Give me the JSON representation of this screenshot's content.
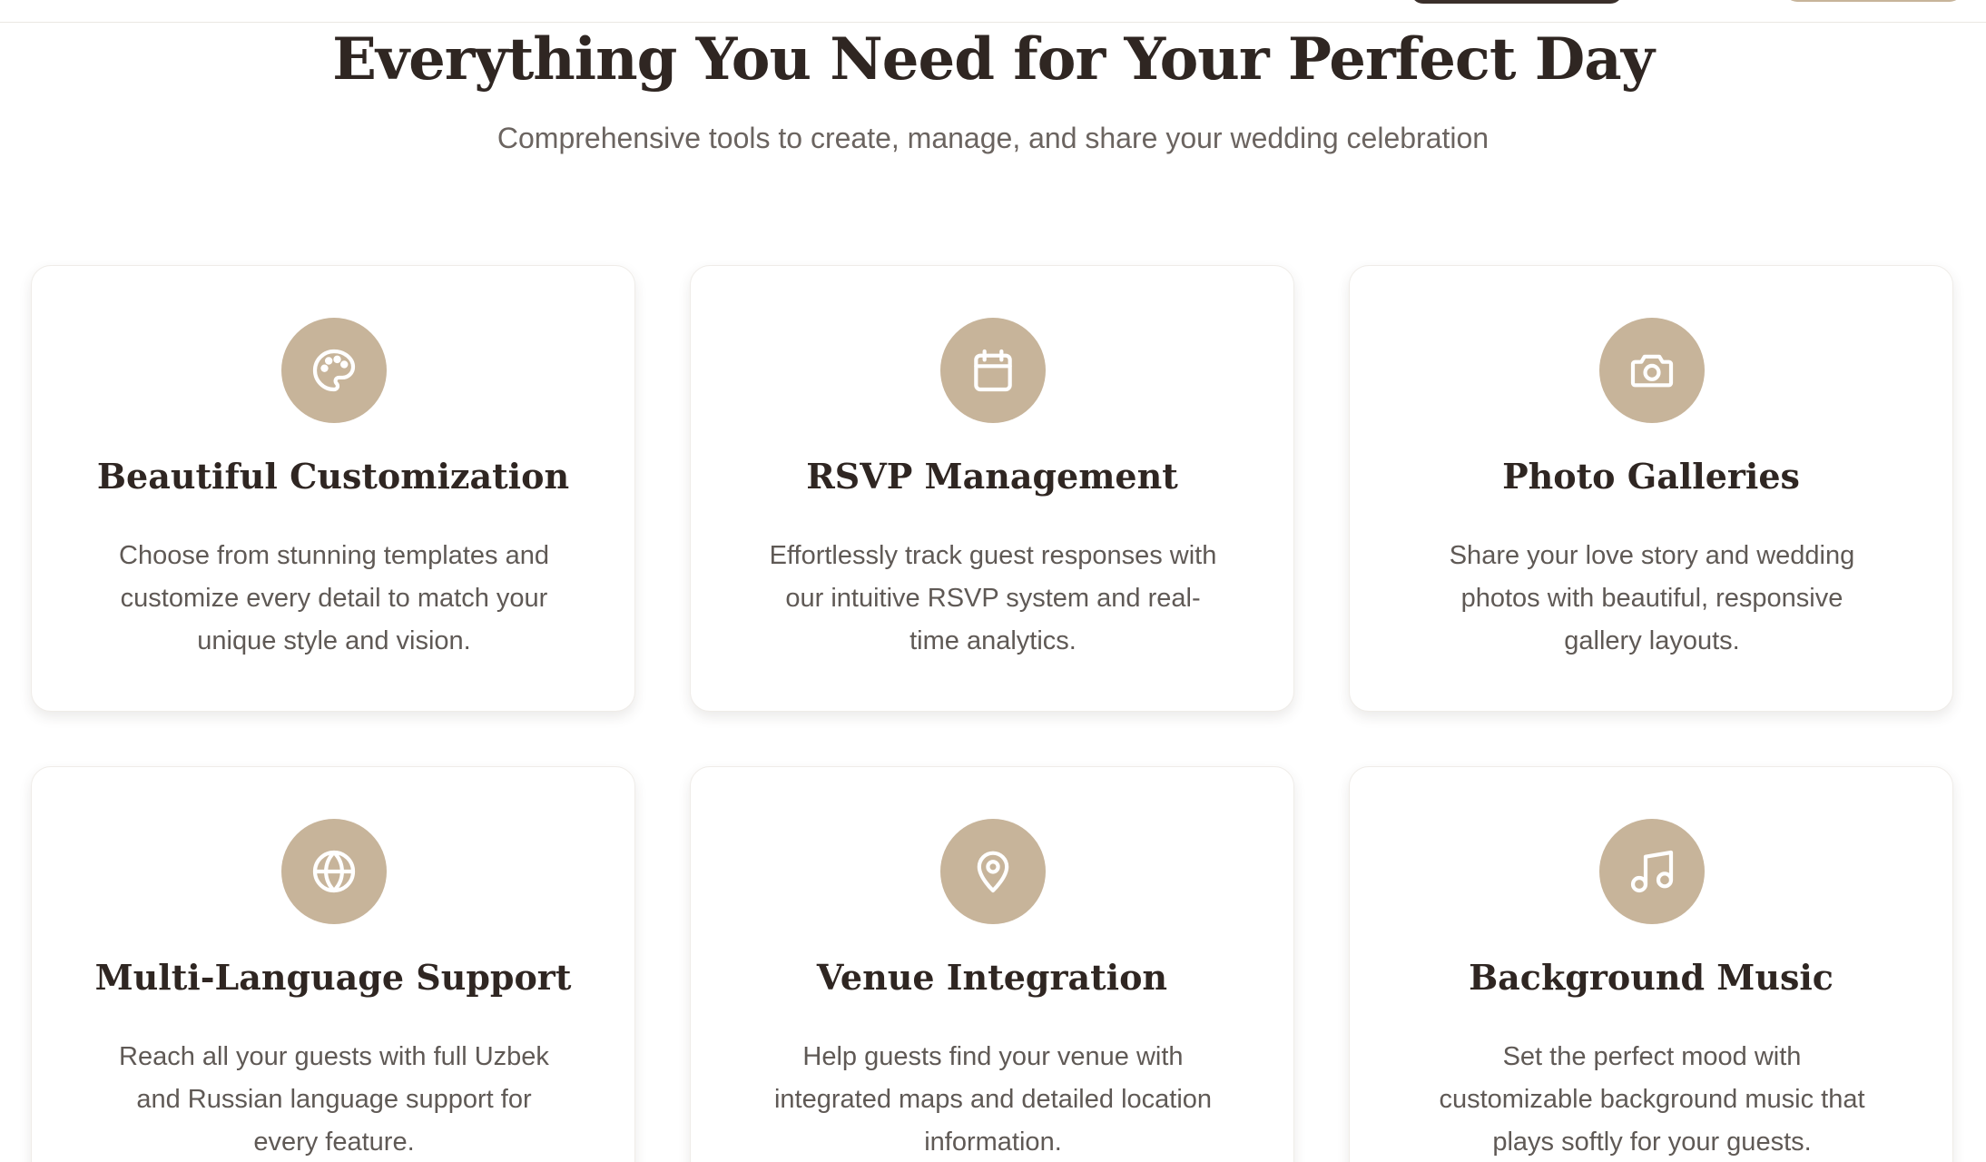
{
  "section": {
    "title": "Everything You Need for Your Perfect Day",
    "subtitle": "Comprehensive tools to create, manage, and share your wedding celebration"
  },
  "theme": {
    "accent": "#c7b49a",
    "heading": "#2f2622",
    "body_text": "#5f5955"
  },
  "features": [
    {
      "icon": "palette-icon",
      "title": "Beautiful Customization",
      "description": "Choose from stunning templates and customize every detail to match your unique style and vision."
    },
    {
      "icon": "calendar-icon",
      "title": "RSVP Management",
      "description": "Effortlessly track guest responses with our intuitive RSVP system and real-time analytics."
    },
    {
      "icon": "camera-icon",
      "title": "Photo Galleries",
      "description": "Share your love story and wedding photos with beautiful, responsive gallery layouts."
    },
    {
      "icon": "globe-icon",
      "title": "Multi-Language Support",
      "description": "Reach all your guests with full Uzbek and Russian language support for every feature."
    },
    {
      "icon": "map-pin-icon",
      "title": "Venue Integration",
      "description": "Help guests find your venue with integrated maps and detailed location information."
    },
    {
      "icon": "music-note-icon",
      "title": "Background Music",
      "description": "Set the perfect mood with customizable background music that plays softly for your guests."
    }
  ]
}
